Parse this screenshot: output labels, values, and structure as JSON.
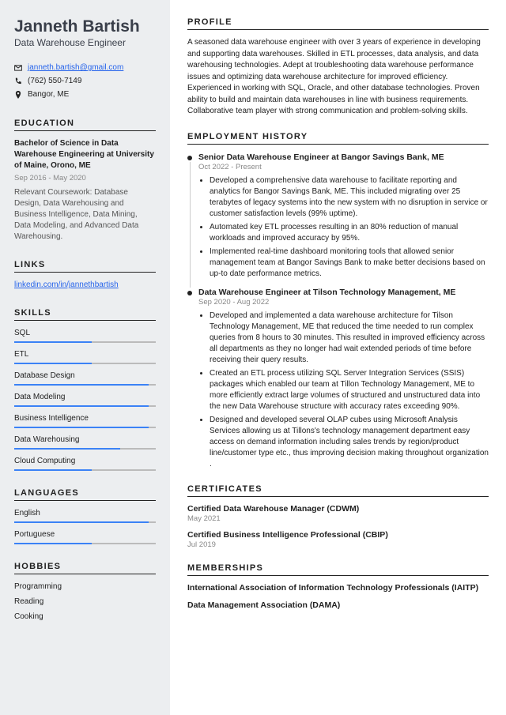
{
  "name": "Janneth Bartish",
  "title": "Data Warehouse Engineer",
  "contact": {
    "email": "janneth.bartish@gmail.com",
    "phone": "(762) 550-7149",
    "location": "Bangor, ME"
  },
  "education": {
    "heading": "EDUCATION",
    "degree": "Bachelor of Science in Data Warehouse Engineering at University of Maine, Orono, ME",
    "dates": "Sep 2016 - May 2020",
    "coursework": "Relevant Coursework: Database Design, Data Warehousing and Business Intelligence, Data Mining, Data Modeling, and Advanced Data Warehousing."
  },
  "links": {
    "heading": "LINKS",
    "items": [
      "linkedin.com/in/jannethbartish"
    ]
  },
  "skills": {
    "heading": "SKILLS",
    "items": [
      {
        "name": "SQL",
        "pct": 55
      },
      {
        "name": "ETL",
        "pct": 55
      },
      {
        "name": "Database Design",
        "pct": 95
      },
      {
        "name": "Data Modeling",
        "pct": 95
      },
      {
        "name": "Business Intelligence",
        "pct": 95
      },
      {
        "name": "Data Warehousing",
        "pct": 75
      },
      {
        "name": "Cloud Computing",
        "pct": 55
      }
    ]
  },
  "languages": {
    "heading": "LANGUAGES",
    "items": [
      {
        "name": "English",
        "pct": 95
      },
      {
        "name": "Portuguese",
        "pct": 55
      }
    ]
  },
  "hobbies": {
    "heading": "HOBBIES",
    "items": [
      "Programming",
      "Reading",
      "Cooking"
    ]
  },
  "profile": {
    "heading": "PROFILE",
    "text": "A seasoned data warehouse engineer with over 3 years of experience in developing and supporting data warehouses. Skilled in ETL processes, data analysis, and data warehousing technologies. Adept at troubleshooting data warehouse performance issues and optimizing data warehouse architecture for improved efficiency. Experienced in working with SQL, Oracle, and other database technologies. Proven ability to build and maintain data warehouses in line with business requirements. Collaborative team player with strong communication and problem-solving skills."
  },
  "employment": {
    "heading": "EMPLOYMENT HISTORY",
    "jobs": [
      {
        "title": "Senior Data Warehouse Engineer at Bangor Savings Bank, ME",
        "dates": "Oct 2022 - Present",
        "bullets": [
          "Developed a comprehensive data warehouse to facilitate reporting and analytics for Bangor Savings Bank, ME. This included migrating over 25 terabytes of legacy systems into the new system with no disruption in service or customer satisfaction levels (99% uptime).",
          "Automated key ETL processes resulting in an 80% reduction of manual workloads and improved accuracy by 95%.",
          "Implemented real-time dashboard monitoring tools that allowed senior management team at Bangor Savings Bank to make better decisions based on up-to date performance metrics."
        ]
      },
      {
        "title": "Data Warehouse Engineer at Tilson Technology Management, ME",
        "dates": "Sep 2020 - Aug 2022",
        "bullets": [
          "Developed and implemented a data warehouse architecture for Tilson Technology Management, ME that reduced the time needed to run complex queries from 8 hours to 30 minutes. This resulted in improved efficiency across all departments as they no longer had wait extended periods of time before receiving their query results.",
          "Created an ETL process utilizing SQL Server Integration Services (SSIS) packages which enabled our team at Tillon Technology Management, ME to more efficiently extract large volumes of structured and unstructured data into the new Data Warehouse structure with accuracy rates exceeding 90%.",
          "Designed and developed several OLAP cubes using Microsoft Analysis Services allowing us at Tillons's technology management department easy access on demand information including sales trends by region/product line/customer type etc., thus improving decision making throughout organization ."
        ]
      }
    ]
  },
  "certificates": {
    "heading": "CERTIFICATES",
    "items": [
      {
        "title": "Certified Data Warehouse Manager (CDWM)",
        "date": "May 2021"
      },
      {
        "title": "Certified Business Intelligence Professional (CBIP)",
        "date": "Jul 2019"
      }
    ]
  },
  "memberships": {
    "heading": "MEMBERSHIPS",
    "items": [
      "International Association of Information Technology Professionals (IAITP)",
      "Data Management Association (DAMA)"
    ]
  }
}
